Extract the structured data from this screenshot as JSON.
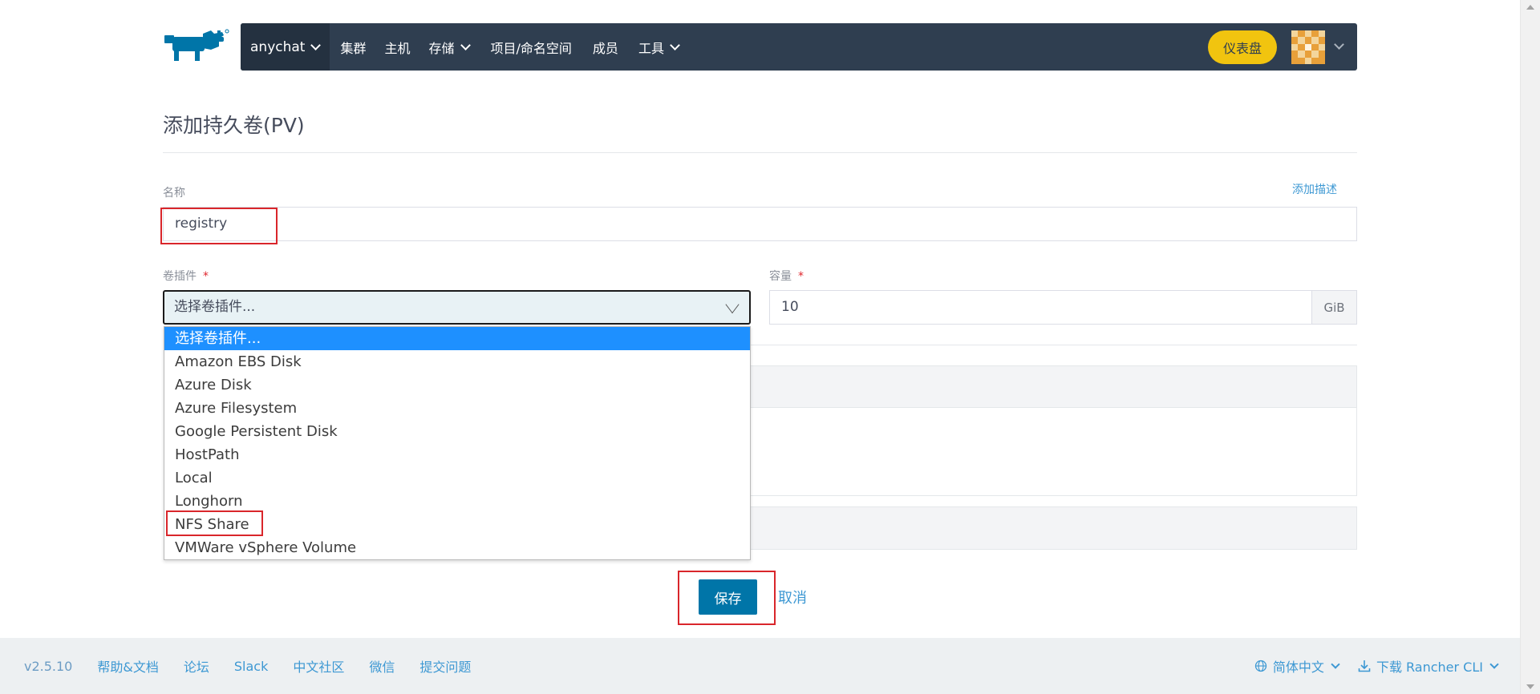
{
  "nav": {
    "cluster_label": "anychat",
    "items": [
      {
        "label": "集群",
        "dropdown": false
      },
      {
        "label": "主机",
        "dropdown": false
      },
      {
        "label": "存储",
        "dropdown": true
      },
      {
        "label": "项目/命名空间",
        "dropdown": false
      },
      {
        "label": "成员",
        "dropdown": false
      },
      {
        "label": "工具",
        "dropdown": true
      }
    ],
    "dashboard_label": "仪表盘"
  },
  "page": {
    "title": "添加持久卷(PV)"
  },
  "form": {
    "name_label": "名称",
    "add_description_link": "添加描述",
    "name_value": "registry",
    "plugin_label": "卷插件",
    "required_mark": "*",
    "plugin_selected": "选择卷插件...",
    "capacity_label": "容量",
    "capacity_value": "10",
    "capacity_unit": "GiB"
  },
  "dropdown": {
    "options": [
      "选择卷插件...",
      "Amazon EBS Disk",
      "Azure Disk",
      "Azure Filesystem",
      "Google Persistent Disk",
      "HostPath",
      "Local",
      "Longhorn",
      "NFS Share",
      "VMWare vSphere Volume"
    ],
    "highlighted_index": 0
  },
  "actions": {
    "save_label": "保存",
    "cancel_label": "取消"
  },
  "footer": {
    "version": "v2.5.10",
    "links": [
      "帮助&文档",
      "论坛",
      "Slack",
      "中文社区",
      "微信",
      "提交问题"
    ],
    "language": "简体中文",
    "cli_download": "下载 Rancher CLI"
  },
  "colors": {
    "navbar": "#2f3e50",
    "accent_blue": "#0075a8",
    "link_blue": "#3d98d3",
    "dashboard_yellow": "#f1c40f",
    "highlight_red": "#d9262b",
    "option_selected": "#1e90ff"
  }
}
